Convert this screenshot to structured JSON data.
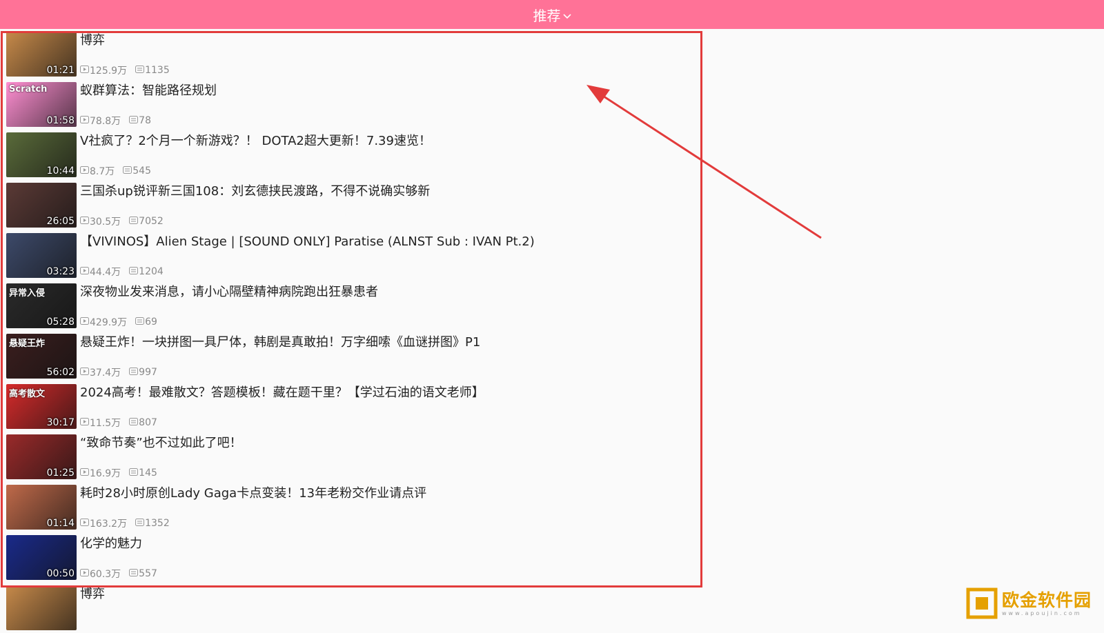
{
  "header": {
    "title": "推荐"
  },
  "videos": [
    {
      "title": "博弈",
      "duration": "01:21",
      "views": "125.9万",
      "comments": "1135",
      "bg": "#c78a4a",
      "thumb_text": ""
    },
    {
      "title": "蚁群算法：智能路径规划",
      "duration": "01:58",
      "views": "78.8万",
      "comments": "78",
      "bg": "#ff8fd2",
      "thumb_text": "Scratch"
    },
    {
      "title": "V社疯了？2个月一个新游戏？！ DOTA2超大更新！7.39速览！",
      "duration": "10:44",
      "views": "8.7万",
      "comments": "545",
      "bg": "#5a6b3a",
      "thumb_text": ""
    },
    {
      "title": "三国杀up锐评新三国108：刘玄德挟民渡路，不得不说确实够新",
      "duration": "26:05",
      "views": "30.5万",
      "comments": "7052",
      "bg": "#5b3a36",
      "thumb_text": ""
    },
    {
      "title": "【VIVINOS】Alien Stage | [SOUND ONLY] Paratise (ALNST Sub : IVAN Pt.2)",
      "duration": "03:23",
      "views": "44.4万",
      "comments": "1204",
      "bg": "#3d4a6a",
      "thumb_text": ""
    },
    {
      "title": "深夜物业发来消息，请小心隔壁精神病院跑出狂暴患者",
      "duration": "05:28",
      "views": "429.9万",
      "comments": "69",
      "bg": "#2a2a2a",
      "thumb_text": "异常入侵"
    },
    {
      "title": "悬疑王炸！一块拼图一具尸体，韩剧是真敢拍！万字细嗦《血谜拼图》P1",
      "duration": "56:02",
      "views": "37.4万",
      "comments": "997",
      "bg": "#3b1e1e",
      "thumb_text": "悬疑王炸"
    },
    {
      "title": "2024高考！最难散文？答题模板！藏在题干里？【学过石油的语文老师】",
      "duration": "30:17",
      "views": "11.5万",
      "comments": "807",
      "bg": "#d62b2b",
      "thumb_text": "高考散文"
    },
    {
      "title": "“致命节奏”也不过如此了吧！",
      "duration": "01:25",
      "views": "16.9万",
      "comments": "145",
      "bg": "#9a2a2a",
      "thumb_text": ""
    },
    {
      "title": "耗时28小时原创Lady Gaga卡点变装！13年老粉交作业请点评",
      "duration": "01:14",
      "views": "163.2万",
      "comments": "1352",
      "bg": "#c06a4a",
      "thumb_text": ""
    },
    {
      "title": "化学的魅力",
      "duration": "00:50",
      "views": "60.3万",
      "comments": "557",
      "bg": "#1a2a8a",
      "thumb_text": ""
    },
    {
      "title": "博弈",
      "duration": "",
      "views": "",
      "comments": "",
      "bg": "#c78a4a",
      "thumb_text": ""
    }
  ],
  "watermark": {
    "name": "欧金软件园",
    "url": "www.apoujin.com"
  },
  "colors": {
    "accent": "#ff7297",
    "highlight": "#e23b3b"
  }
}
